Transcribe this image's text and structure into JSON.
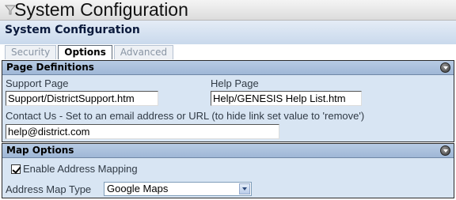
{
  "header": {
    "title": "System Configuration",
    "subtitle": "System Configuration"
  },
  "tabs": [
    {
      "label": "Security",
      "active": false
    },
    {
      "label": "Options",
      "active": true
    },
    {
      "label": "Advanced",
      "active": false
    }
  ],
  "page_definitions": {
    "heading": "Page Definitions",
    "support_page_label": "Support Page",
    "support_page_value": "Support/DistrictSupport.htm",
    "help_page_label": "Help Page",
    "help_page_value": "Help/GENESIS Help List.htm",
    "contact_label": "Contact Us - Set to an email address or URL (to hide link set value to 'remove')",
    "contact_value": "help@district.com"
  },
  "map_options": {
    "heading": "Map Options",
    "enable_mapping_label": "Enable Address Mapping",
    "enable_mapping_checked": true,
    "map_type_label": "Address Map Type",
    "map_type_value": "Google Maps"
  },
  "icons": {
    "title": "funnel-icon",
    "collapse": "collapse-arrow-icon",
    "dropdown": "chevron-down-icon"
  },
  "colors": {
    "section_header": "#9fb7d6",
    "section_body": "#d8e5f3",
    "sub_header": "#c9d9ec"
  }
}
